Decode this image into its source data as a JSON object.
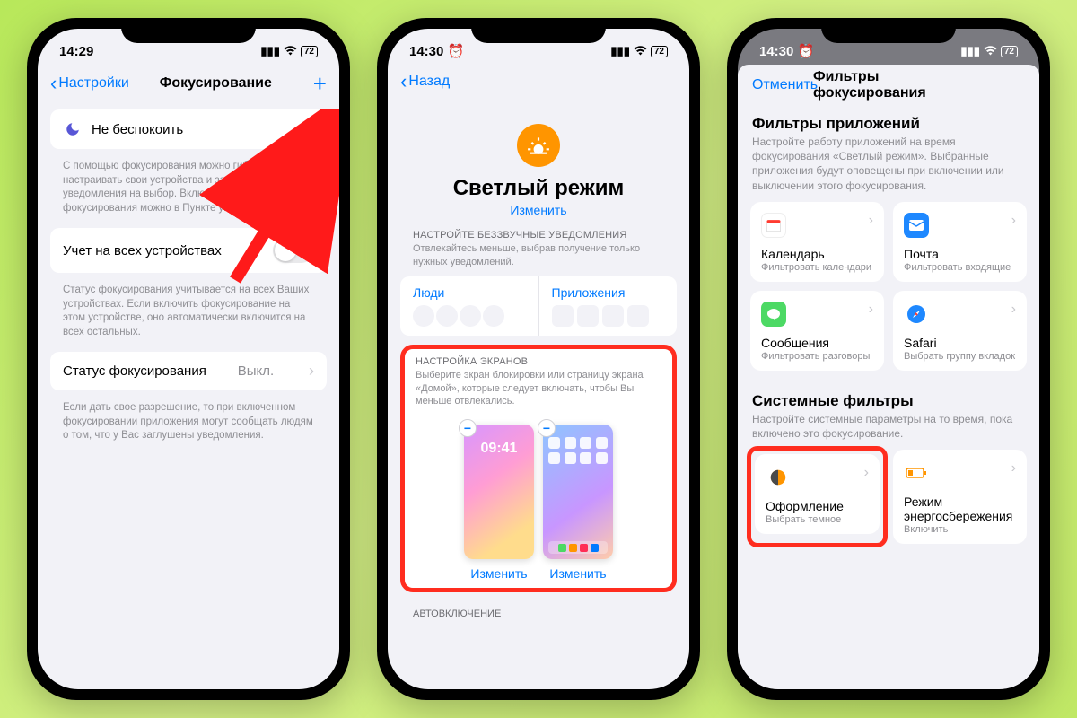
{
  "phone1": {
    "time": "14:29",
    "battery": "72",
    "nav_back": "Настройки",
    "nav_title": "Фокусирование",
    "dnd": "Не беспокоить",
    "footer1": "С помощью фокусирования можно гибко настраивать свои устройства и заглушать вызовы и уведомления на выбор. Включать и выключать фокусирования можно в Пункте управления.",
    "share_label": "Учет на всех устройствах",
    "footer2": "Статус фокусирования учитывается на всех Ваших устройствах. Если включить фокусирование на этом устройстве, оно автоматически включится на всех остальных.",
    "focus_status": "Статус фокусирования",
    "focus_status_value": "Выкл.",
    "footer3": "Если дать свое разрешение, то при включенном фокусировании приложения могут сообщать людям о том, что у Вас заглушены уведомления."
  },
  "phone2": {
    "time": "14:30",
    "battery": "72",
    "nav_back": "Назад",
    "focus_title": "Светлый режим",
    "change": "Изменить",
    "sec1_header": "НАСТРОЙТЕ БЕЗЗВУЧНЫЕ УВЕДОМЛЕНИЯ",
    "sec1_sub": "Отвлекайтесь меньше, выбрав получение только нужных уведомлений.",
    "people": "Люди",
    "apps": "Приложения",
    "sec2_header": "НАСТРОЙКА ЭКРАНОВ",
    "sec2_sub": "Выберите экран блокировки или страницу экрана «Домой», которые следует включать, чтобы Вы меньше отвлекались.",
    "mini_time": "09:41",
    "edit": "Изменить",
    "auto": "АВТОВКЛЮЧЕНИЕ"
  },
  "phone3": {
    "time": "14:30",
    "battery": "72",
    "cancel": "Отменить",
    "title": "Фильтры фокусирования",
    "app_filters": "Фильтры приложений",
    "app_filters_desc": "Настройте работу приложений на время фокусирования «Светлый режим». Выбранные приложения будут оповещены при включении или выключении этого фокусирования.",
    "calendar": "Календарь",
    "calendar_sub": "Фильтровать календари",
    "mail": "Почта",
    "mail_sub": "Фильтровать входящие",
    "messages": "Сообщения",
    "messages_sub": "Фильтровать разговоры",
    "safari": "Safari",
    "safari_sub": "Выбрать группу вкладок",
    "sys_filters": "Системные фильтры",
    "sys_filters_desc": "Настройте системные параметры на то время, пока включено это фокусирование.",
    "appearance": "Оформление",
    "appearance_sub": "Выбрать темное",
    "lowpower": "Режим энергосбережения",
    "lowpower_sub": "Включить"
  }
}
